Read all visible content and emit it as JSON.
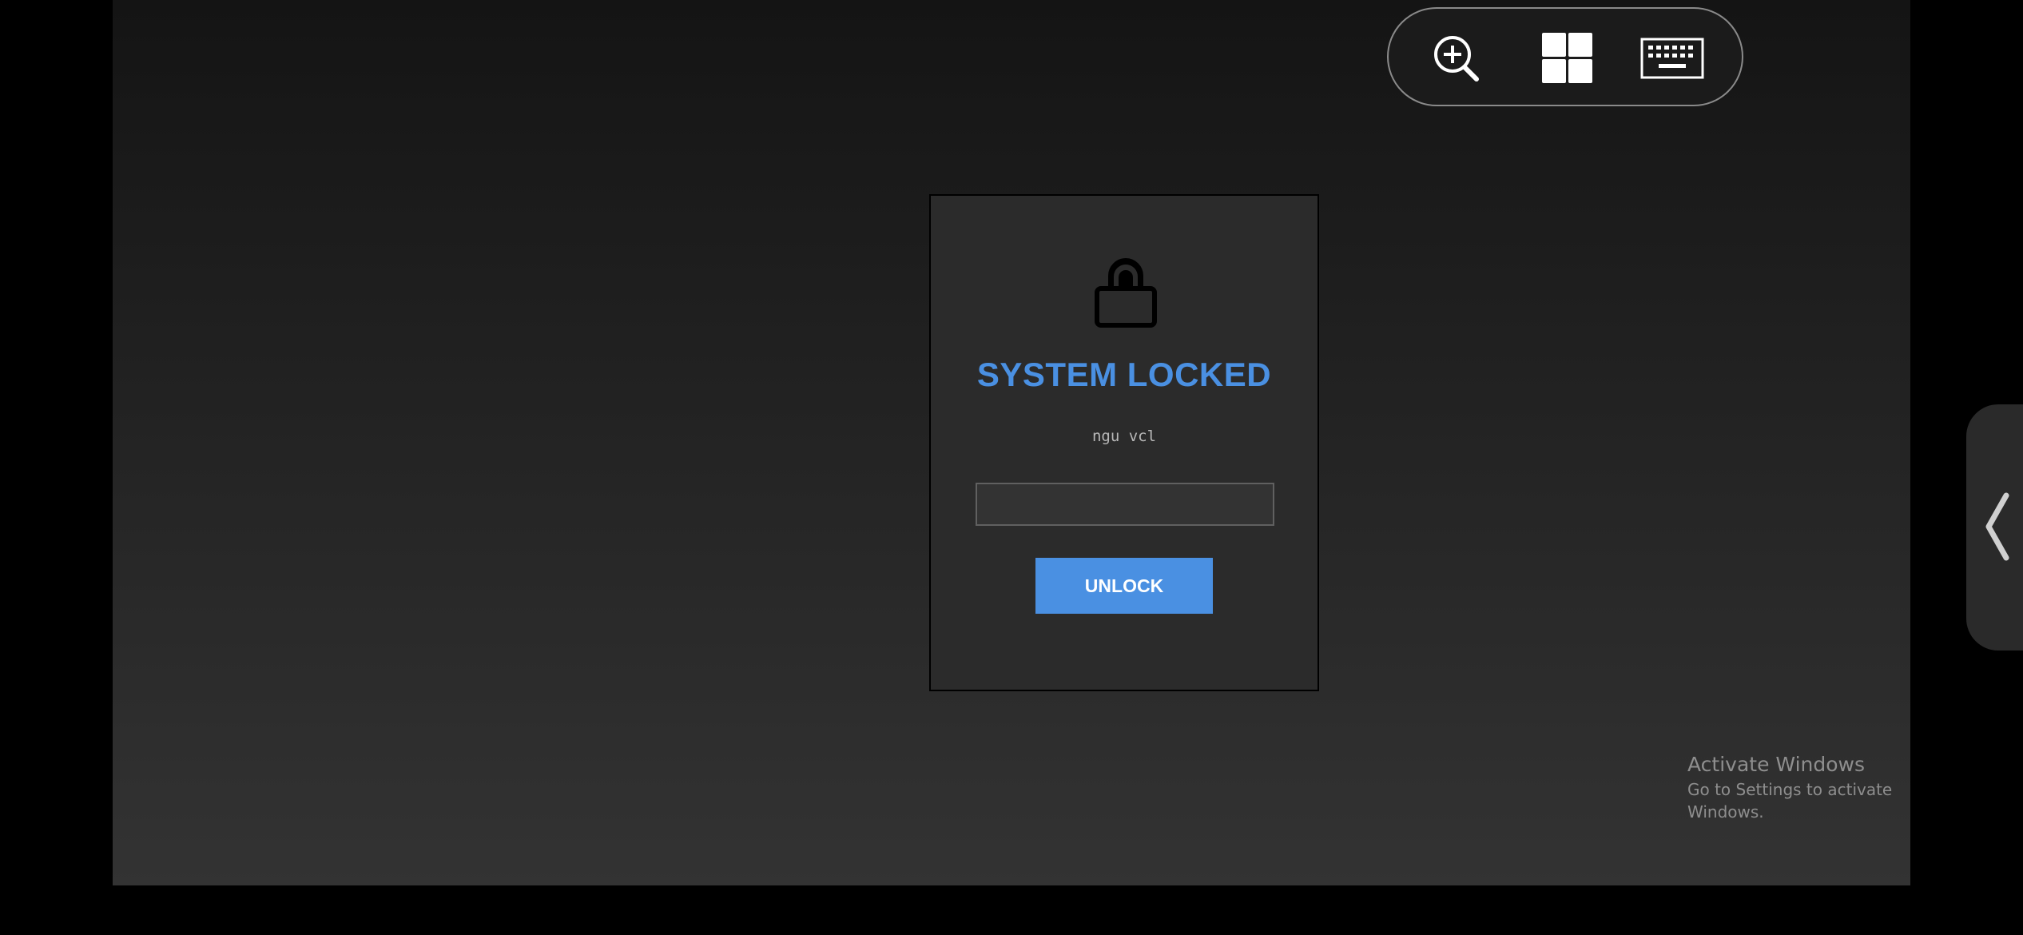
{
  "toolbar": {
    "icons": [
      "zoom-in-icon",
      "windows-icon",
      "keyboard-icon"
    ]
  },
  "lock_screen": {
    "icon": "padlock-icon",
    "title": "SYSTEM LOCKED",
    "subtitle": "ngu vcl",
    "password_value": "",
    "button_label": "UNLOCK",
    "accent_color": "#4a90e2"
  },
  "watermark": {
    "title": "Activate Windows",
    "subtitle": "Go to Settings to activate Windows."
  },
  "side_panel": {
    "icon": "chevron-left-icon"
  }
}
